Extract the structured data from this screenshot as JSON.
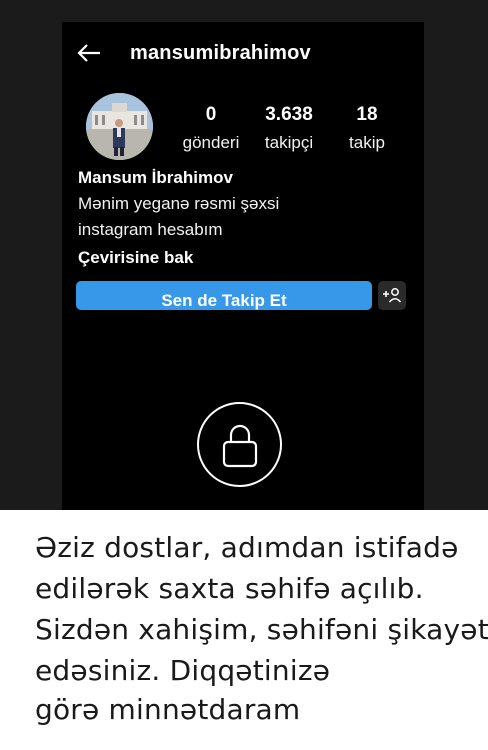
{
  "profile": {
    "username": "mansumibrahimov",
    "full_name": "Mansum İbrahimov",
    "bio_line1": "Mənim yeganə rəsmi şəxsi",
    "bio_line2": "instagram hesabım",
    "translate_label": "Çevirisine bak"
  },
  "stats": [
    {
      "value": "0",
      "label": "gönderi"
    },
    {
      "value": "3.638",
      "label": "takipçi"
    },
    {
      "value": "18",
      "label": "takip"
    }
  ],
  "actions": {
    "follow_label": "Sen de Takip Et"
  },
  "icons": {
    "back": "back-arrow-icon",
    "add_person": "add-person-icon",
    "lock": "lock-icon"
  },
  "colors": {
    "follow_button": "#3798ea",
    "background": "#000000",
    "caption_background": "#ffffff"
  },
  "caption": {
    "line1": "Əziz dostlar, adımdan istifadə",
    "line2": "edilərək saxta səhifə açılıb.",
    "line3": "Sizdən xahişim, səhifəni şikayət",
    "line4": "edəsiniz. Diqqətinizə",
    "line5": "görə minnətdaram"
  }
}
